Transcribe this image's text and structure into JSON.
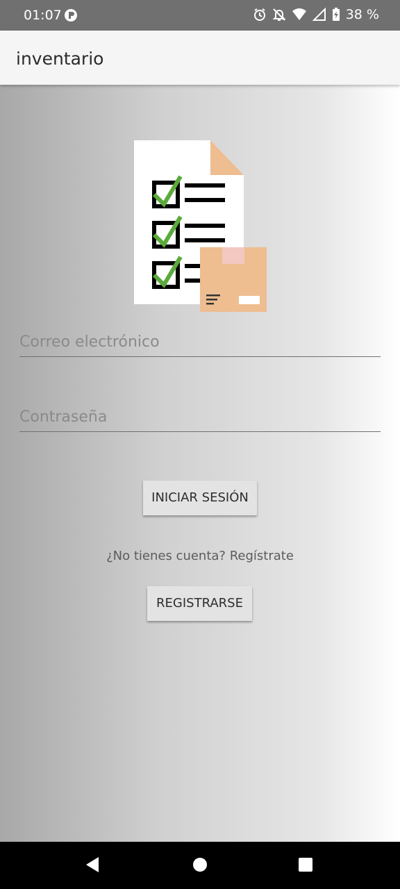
{
  "status_bar": {
    "time": "01:07",
    "battery": "38 %",
    "icons": [
      "app-notification-icon",
      "alarm-icon",
      "notifications-off-icon",
      "wifi-icon",
      "signal-icon",
      "battery-charging-icon"
    ]
  },
  "app_bar": {
    "title": "inventario"
  },
  "illustration": {
    "icon": "inventory-checklist-box-icon",
    "colors": {
      "check": "#5aaa3c",
      "box": "#eebd90",
      "box_tape": "#f2c8c0",
      "page": "#ffffff",
      "fold": "#eebd90"
    }
  },
  "form": {
    "email_placeholder": "Correo electrónico",
    "email_value": "",
    "password_placeholder": "Contraseña",
    "password_value": "",
    "login_label": "INICIAR SESIÓN",
    "no_account_text": "¿No tienes cuenta? Regístrate",
    "register_label": "REGISTRARSE"
  },
  "nav_bar": {
    "icons": [
      "back-icon",
      "home-icon",
      "recents-icon"
    ]
  }
}
